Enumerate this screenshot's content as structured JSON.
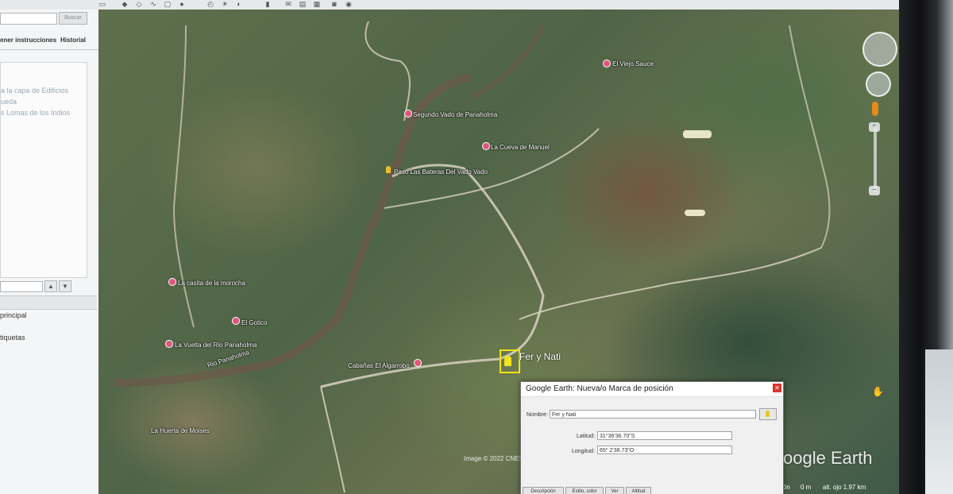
{
  "sidebar": {
    "search_button": "Buscar",
    "tabs": [
      "ener instrucciones",
      "Historial"
    ],
    "layers_text": [
      "a la capa de Edificios",
      "ueda",
      "s Lomas de los Indios"
    ],
    "places_items": [
      "principal",
      "tiquetas"
    ]
  },
  "map": {
    "labels": [
      {
        "text": "El Viejo Sauce"
      },
      {
        "text": "Segundo Vado de Panaholma"
      },
      {
        "text": "La Cueva de Manuel"
      },
      {
        "text": "Paso Las Bateras Del Vado Vado"
      },
      {
        "text": "La casita de la morocha"
      },
      {
        "text": "El Gotico"
      },
      {
        "text": "La Vuelta del Rio Panaholma"
      },
      {
        "text": "Rio Panaholma"
      },
      {
        "text": "Cabañas El Algarrobo"
      },
      {
        "text": "La Huerta de Moises"
      }
    ],
    "new_placemark_label": "Fer y Nati",
    "imagery": "Image © 2022 CNES / Airbus",
    "watermark": "oogle Earth",
    "status": {
      "left": "ción",
      "elev": "0 m",
      "alt": "alt. ojo  1.97 km"
    }
  },
  "dialog": {
    "title": "Google Earth: Nueva/o Marca de posición",
    "name_label": "Nombre:",
    "name_value": "Fer y Nati",
    "lat_label": "Latitud:",
    "lat_value": "31°36'36.70\"S",
    "lon_label": "Longitud:",
    "lon_value": "65° 2'38.73\"O",
    "tabs": [
      "Descripción",
      "Estilo, color",
      "Ver",
      "Altitud"
    ]
  },
  "colors": {
    "pin": "#e0567a",
    "selection": "#f2e21a",
    "close": "#d9342b"
  }
}
